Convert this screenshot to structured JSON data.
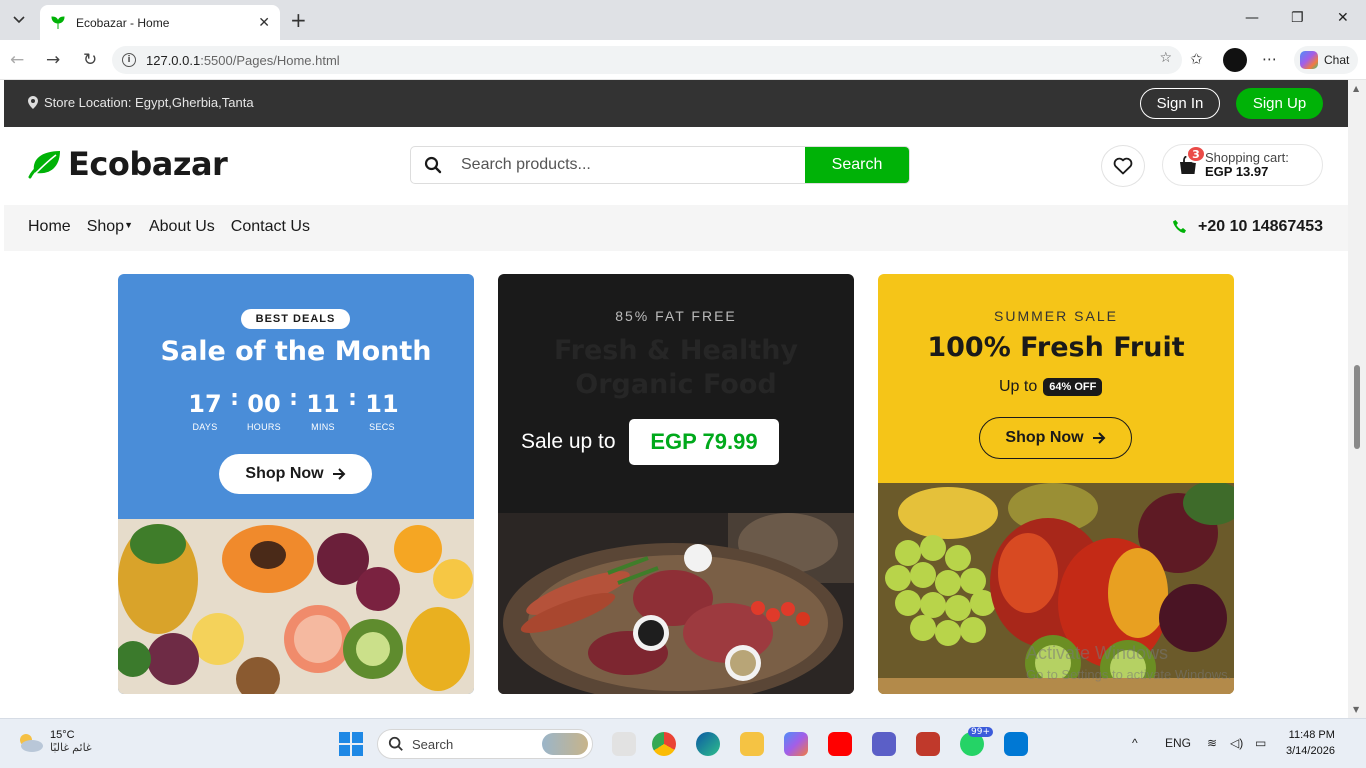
{
  "browser": {
    "tab_title": "Ecobazar - Home",
    "url_host": "127.0.0.1",
    "url_rest": ":5500/Pages/Home.html",
    "chat_label": "Chat"
  },
  "topbar": {
    "location": "Store Location: Egypt,Gherbia,Tanta",
    "signin_label": "Sign In",
    "signup_label": "Sign Up"
  },
  "header": {
    "logo_text": "Ecobazar",
    "search_placeholder": "Search products...",
    "search_button": "Search",
    "cart_count": "3",
    "cart_label": "Shopping cart:",
    "cart_amount": "EGP 13.97"
  },
  "nav": {
    "items": [
      "Home",
      "Shop",
      "About Us",
      "Contact Us"
    ],
    "phone": "+20 10 14867453"
  },
  "cards": {
    "deals": {
      "pill": "BEST DEALS",
      "title": "Sale of the Month",
      "countdown": [
        {
          "value": "17",
          "unit": "DAYS"
        },
        {
          "value": "00",
          "unit": "HOURS"
        },
        {
          "value": "11",
          "unit": "MINS"
        },
        {
          "value": "11",
          "unit": "SECS"
        }
      ],
      "button": "Shop Now"
    },
    "organic": {
      "tag": "85% FAT FREE",
      "title_line1": "Fresh & Healthy",
      "title_line2": "Organic Food",
      "sale_text": "Sale up to",
      "price": "EGP 79.99"
    },
    "summer": {
      "tag": "SUMMER SALE",
      "title": "100% Fresh Fruit",
      "upto": "Up to",
      "off": "64% OFF",
      "button": "Shop Now"
    }
  },
  "watermark": {
    "line1": "Activate Windows",
    "line2": "Go to Settings to activate Windows."
  },
  "taskbar": {
    "temp": "15°C",
    "weather_desc": "غائم غالبًا",
    "search_label": "Search",
    "lang": "ENG",
    "time": "11:48 PM",
    "date": "3/14/2026",
    "whatsapp_badge": "99+"
  },
  "colors": {
    "accent_green": "#00b207",
    "topbar_dark": "#333333",
    "card_blue": "#4a8dd8",
    "card_dark": "#1a1a1a",
    "card_yellow": "#f5c518"
  }
}
